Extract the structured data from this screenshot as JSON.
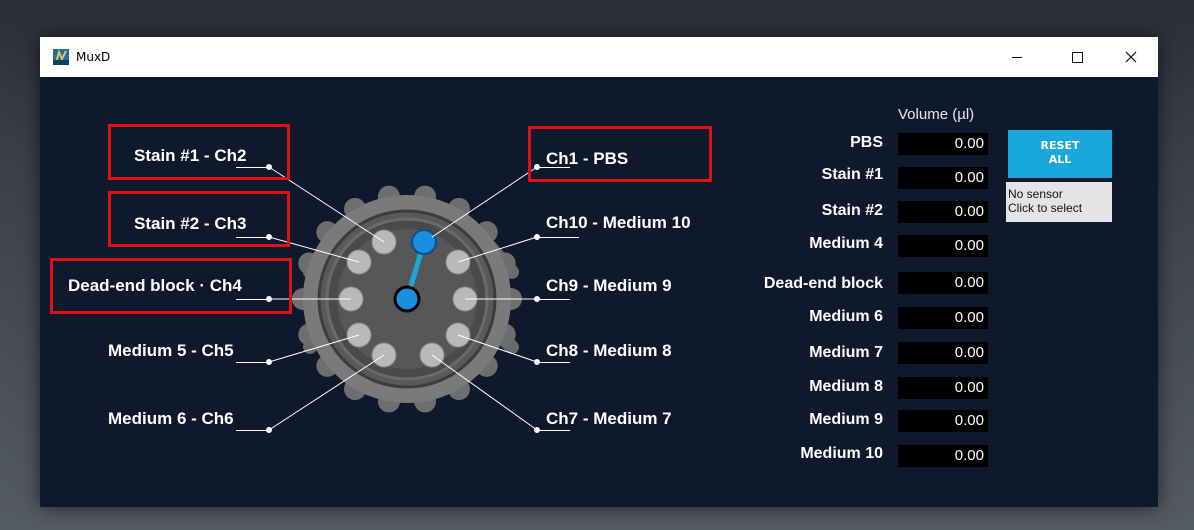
{
  "window": {
    "title": "MuxD",
    "minimize_glyph": "minimize-icon",
    "maximize_glyph": "maximize-icon",
    "close_glyph": "close-icon"
  },
  "colors": {
    "background": "#0e1a2b",
    "accent": "#1aa8dc",
    "highlight_box": "#e01019",
    "field_bg": "#000000"
  },
  "valve": {
    "labels_left": [
      {
        "name": "Stain #1",
        "sep": " - ",
        "channel": "Ch2",
        "highlighted": true
      },
      {
        "name": "Stain #2",
        "sep": " - ",
        "channel": "Ch3",
        "highlighted": true
      },
      {
        "name": "Dead-end block",
        "sep": " · ",
        "channel": "Ch4",
        "highlighted": true
      },
      {
        "name": "Medium 5",
        "sep": " - ",
        "channel": "Ch5",
        "highlighted": false
      },
      {
        "name": "Medium 6",
        "sep": " - ",
        "channel": "Ch6",
        "highlighted": false
      }
    ],
    "labels_right": [
      {
        "channel": "Ch1",
        "sep": " -  ",
        "name": "PBS",
        "highlighted": true
      },
      {
        "channel": "Ch10",
        "sep": " - ",
        "name": "Medium 10",
        "highlighted": false
      },
      {
        "channel": "Ch9",
        "sep": " - ",
        "name": "Medium 9",
        "highlighted": false
      },
      {
        "channel": "Ch8",
        "sep": " - ",
        "name": "Medium 8",
        "highlighted": false
      },
      {
        "channel": "Ch7",
        "sep": " - ",
        "name": "Medium 7",
        "highlighted": false
      }
    ],
    "active_channel": "Ch1"
  },
  "volume": {
    "header": "Volume (µl)",
    "rows": [
      {
        "label": "PBS",
        "value": "0.00"
      },
      {
        "label": "Stain #1",
        "value": "0.00"
      },
      {
        "label": "Stain #2",
        "value": "0.00"
      },
      {
        "label": "Medium 4",
        "value": "0.00"
      },
      {
        "label": "Dead-end block",
        "value": "0.00"
      },
      {
        "label": "Medium 6",
        "value": "0.00"
      },
      {
        "label": "Medium 7",
        "value": "0.00"
      },
      {
        "label": "Medium 8",
        "value": "0.00"
      },
      {
        "label": "Medium 9",
        "value": "0.00"
      },
      {
        "label": "Medium 10",
        "value": "0.00"
      }
    ]
  },
  "reset_button": {
    "line1": "RESET",
    "line2": "ALL"
  },
  "sensor": {
    "line1": "No sensor",
    "line2": "Click to select"
  }
}
